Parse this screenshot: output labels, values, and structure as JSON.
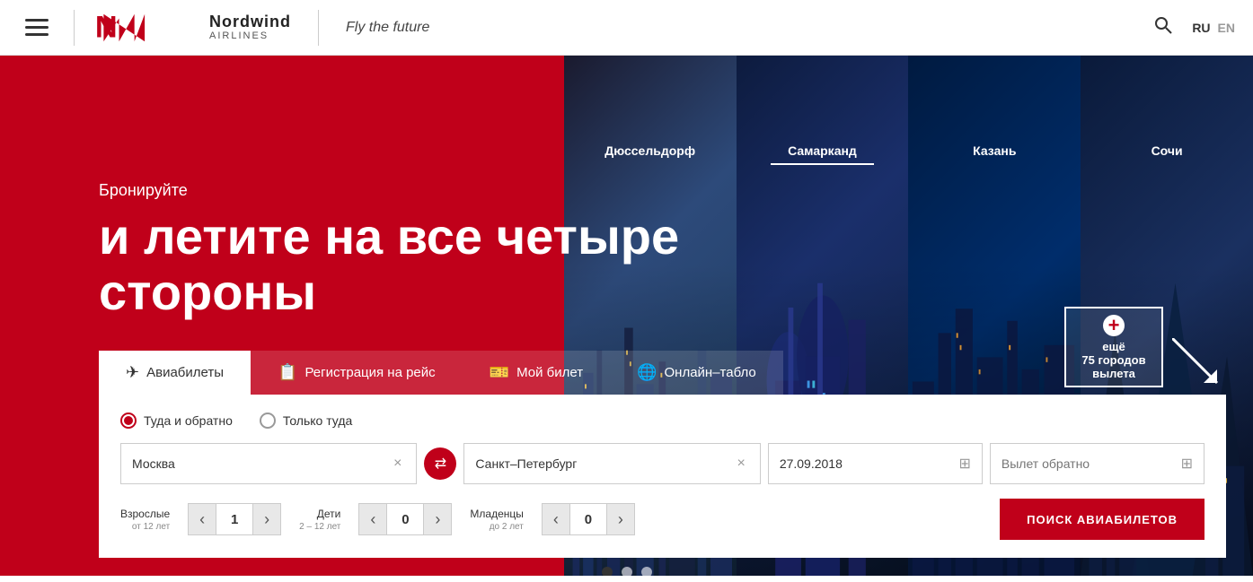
{
  "header": {
    "logo_brand": "Nordwind",
    "logo_sub": "Airlines",
    "tagline": "Fly the future",
    "lang_ru": "RU",
    "lang_en": "EN"
  },
  "hero": {
    "subtitle": "Бронируйте",
    "title": "и летите на все четыре стороны",
    "more_cities_plus": "+",
    "more_cities_text1": "ещё",
    "more_cities_text2": "75 городов",
    "more_cities_text3": "вылета"
  },
  "city_tabs": [
    {
      "name": "Дюссельдорф",
      "active": false
    },
    {
      "name": "Самарканд",
      "active": true
    },
    {
      "name": "Казань",
      "active": false
    },
    {
      "name": "Сочи",
      "active": false
    }
  ],
  "booking": {
    "tabs": [
      {
        "label": "Авиабилеты",
        "active": true
      },
      {
        "label": "Регистрация на рейс",
        "active": false
      },
      {
        "label": "Мой билет",
        "active": false
      },
      {
        "label": "Онлайн–табло",
        "active": false
      }
    ],
    "radio_options": [
      {
        "label": "Туда и обратно",
        "checked": true
      },
      {
        "label": "Только туда",
        "checked": false
      }
    ],
    "from_value": "Москва",
    "to_value": "Санкт–Петербург",
    "date_value": "27.09.2018",
    "date_back_placeholder": "Вылет обратно",
    "passengers": {
      "adults": {
        "label": "Взрослые",
        "sublabel": "от 12 лет",
        "value": 1
      },
      "children": {
        "label": "Дети",
        "sublabel": "2 – 12 лет",
        "value": 0
      },
      "infants": {
        "label": "Младенцы",
        "sublabel": "до 2 лет",
        "value": 0
      }
    },
    "search_button": "ПОИСК АВИАБИЛЕТОВ"
  },
  "dots": [
    {
      "active": true
    },
    {
      "active": false
    },
    {
      "active": false
    }
  ]
}
